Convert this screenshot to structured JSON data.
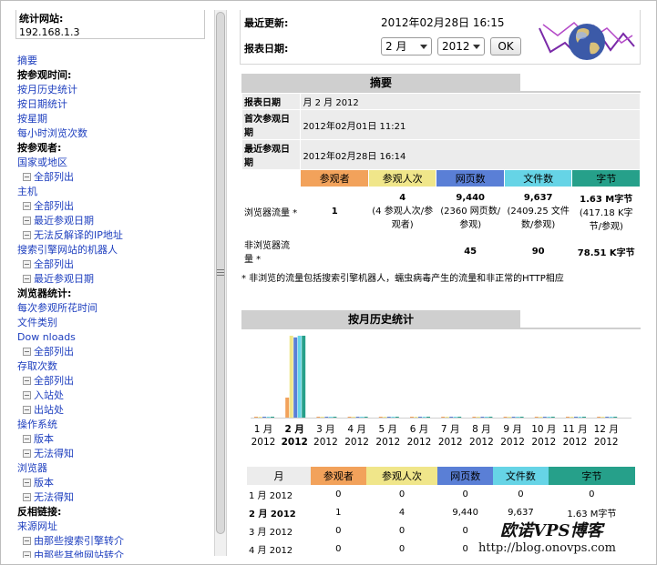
{
  "sidebar": {
    "site_label": "统计网站:",
    "site_value": "192.168.1.3",
    "items": [
      {
        "type": "link",
        "text": "摘要"
      },
      {
        "type": "head",
        "text": "按参观时间:"
      },
      {
        "type": "link",
        "text": "按月历史统计"
      },
      {
        "type": "link",
        "text": "按日期统计"
      },
      {
        "type": "link",
        "text": "按星期"
      },
      {
        "type": "link",
        "text": "每小时浏览次数"
      },
      {
        "type": "head",
        "text": "按参观者:"
      },
      {
        "type": "link",
        "text": "国家或地区"
      },
      {
        "type": "sub",
        "text": "全部列出"
      },
      {
        "type": "link",
        "text": "主机"
      },
      {
        "type": "sub",
        "text": "全部列出"
      },
      {
        "type": "sub",
        "text": "最近参观日期"
      },
      {
        "type": "sub",
        "text": "无法反解译的IP地址"
      },
      {
        "type": "link",
        "text": "搜索引擎网站的机器人"
      },
      {
        "type": "sub",
        "text": "全部列出"
      },
      {
        "type": "sub",
        "text": "最近参观日期"
      },
      {
        "type": "head",
        "text": "浏览器统计:"
      },
      {
        "type": "link",
        "text": "每次参观所花时间"
      },
      {
        "type": "link",
        "text": "文件类别"
      },
      {
        "type": "link",
        "text": "Dow nloads"
      },
      {
        "type": "sub",
        "text": "全部列出"
      },
      {
        "type": "link",
        "text": "存取次数"
      },
      {
        "type": "sub",
        "text": "全部列出"
      },
      {
        "type": "sub",
        "text": "入站处"
      },
      {
        "type": "sub",
        "text": "出站处"
      },
      {
        "type": "link",
        "text": "操作系统"
      },
      {
        "type": "sub",
        "text": "版本"
      },
      {
        "type": "sub",
        "text": "无法得知"
      },
      {
        "type": "link",
        "text": "浏览器"
      },
      {
        "type": "sub",
        "text": "版本"
      },
      {
        "type": "sub",
        "text": "无法得知"
      },
      {
        "type": "head",
        "text": "反相链接:"
      },
      {
        "type": "link",
        "text": "来源网址"
      },
      {
        "type": "sub",
        "text": "由那些搜索引擎转介"
      },
      {
        "type": "sub",
        "text": "由那些其他网站转介"
      }
    ]
  },
  "header": {
    "last_update_label": "最近更新:",
    "last_update_value": "2012年02月28日 16:15",
    "report_date_label": "报表日期:",
    "month_select": "2 月",
    "year_select": "2012",
    "ok_button": "OK"
  },
  "summary": {
    "title": "摘要",
    "report_date_label": "报表日期",
    "report_date_value": "月 2 月 2012",
    "first_visit_label": "首次参观日期",
    "first_visit_value": "2012年02月01日 11:21",
    "last_visit_label": "最近参观日期",
    "last_visit_value": "2012年02月28日 16:14",
    "columns": [
      "参观者",
      "参观人次",
      "网页数",
      "文件数",
      "字节"
    ],
    "browser_traffic_label": "浏览器流量 *",
    "browser_row": {
      "visitors": "1",
      "visits": "4",
      "visits_sub": "(4 参观人次/参观者)",
      "pages": "9,440",
      "pages_sub": "(2360 网页数/参观)",
      "files": "9,637",
      "files_sub": "(2409.25 文件数/参观)",
      "bytes": "1.63 M字节",
      "bytes_sub": "(417.18 K字节/参观)"
    },
    "non_browser_label": "非浏览器流量 *",
    "non_browser_row": {
      "pages": "45",
      "files": "90",
      "bytes": "78.51 K字节"
    },
    "note": "* 非浏览的流量包括搜索引擎机器人，蠕虫病毒产生的流量和非正常的HTTP相应"
  },
  "monthly": {
    "title": "按月历史统计",
    "colors": {
      "visitors": "#f2a25b",
      "visits": "#f0e68a",
      "pages": "#5a7fd6",
      "files": "#66d4e6",
      "bytes": "#26a08a"
    },
    "months": [
      {
        "m": "1 月",
        "y": "2012"
      },
      {
        "m": "2 月",
        "y": "2012"
      },
      {
        "m": "3 月",
        "y": "2012"
      },
      {
        "m": "4 月",
        "y": "2012"
      },
      {
        "m": "5 月",
        "y": "2012"
      },
      {
        "m": "6 月",
        "y": "2012"
      },
      {
        "m": "7 月",
        "y": "2012"
      },
      {
        "m": "8 月",
        "y": "2012"
      },
      {
        "m": "9 月",
        "y": "2012"
      },
      {
        "m": "10 月",
        "y": "2012"
      },
      {
        "m": "11 月",
        "y": "2012"
      },
      {
        "m": "12 月",
        "y": "2012"
      }
    ],
    "chart_values": {
      "visitors": [
        0,
        1,
        0,
        0,
        0,
        0,
        0,
        0,
        0,
        0,
        0,
        0
      ],
      "visits": [
        0,
        4,
        0,
        0,
        0,
        0,
        0,
        0,
        0,
        0,
        0,
        0
      ],
      "pages": [
        0,
        9440,
        0,
        0,
        0,
        0,
        0,
        0,
        0,
        0,
        0,
        0
      ],
      "files": [
        0,
        9637,
        0,
        0,
        0,
        0,
        0,
        0,
        0,
        0,
        0,
        0
      ],
      "bytes": [
        0,
        1.63,
        0,
        0,
        0,
        0,
        0,
        0,
        0,
        0,
        0,
        0
      ]
    },
    "table_headers": [
      "月",
      "参观者",
      "参观人次",
      "网页数",
      "文件数",
      "字节"
    ],
    "rows": [
      {
        "month": "1 月 2012",
        "visitors": "0",
        "visits": "0",
        "pages": "0",
        "files": "0",
        "bytes": "0",
        "bold": false
      },
      {
        "month": "2 月 2012",
        "visitors": "1",
        "visits": "4",
        "pages": "9,440",
        "files": "9,637",
        "bytes": "1.63 M字节",
        "bold": true
      },
      {
        "month": "3 月 2012",
        "visitors": "0",
        "visits": "0",
        "pages": "0",
        "files": "",
        "bytes": "",
        "bold": false
      },
      {
        "month": "4 月 2012",
        "visitors": "0",
        "visits": "0",
        "pages": "0",
        "files": "",
        "bytes": "",
        "bold": false
      }
    ]
  },
  "watermark": {
    "line1": "欧诺VPS博客",
    "line2": "http://blog.onovps.com"
  }
}
